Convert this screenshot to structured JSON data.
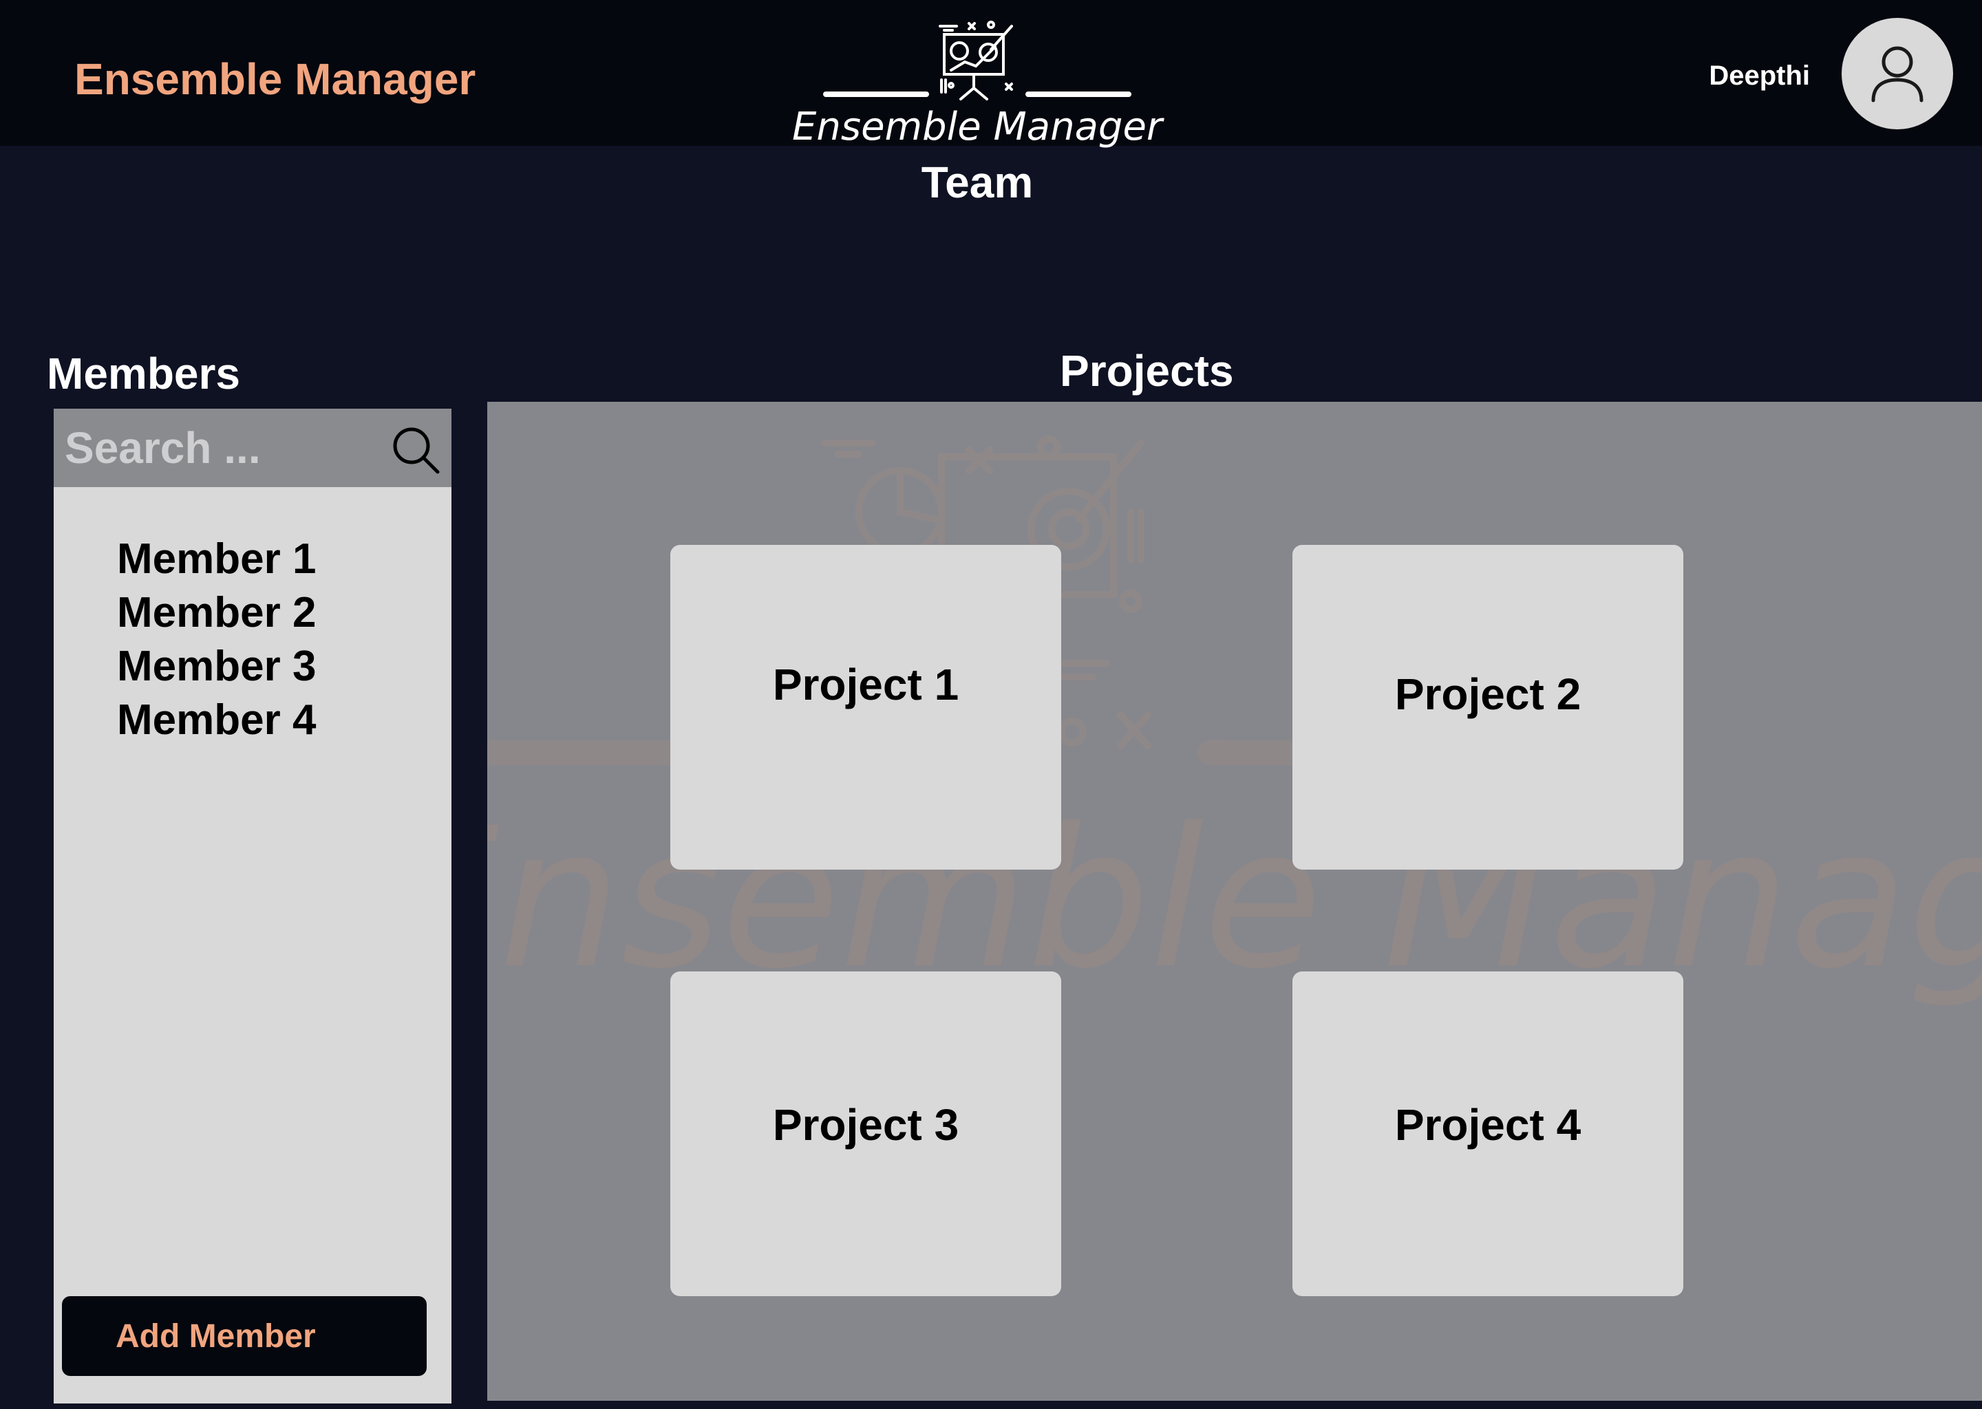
{
  "header": {
    "brand": "Ensemble Manager",
    "logo_text": "Ensemble Manager",
    "username": "Deepthi"
  },
  "page": {
    "title": "Team"
  },
  "members": {
    "heading": "Members",
    "search_placeholder": "Search ...",
    "items": [
      "Member 1",
      "Member 2",
      "Member 3",
      "Member 4"
    ],
    "add_button": "Add Member"
  },
  "projects": {
    "heading": "Projects",
    "items": [
      "Project 1",
      "Project 2",
      "Project 3",
      "Project 4"
    ],
    "watermark": "Ensemble Manager"
  },
  "colors": {
    "accent": "#f1a57f",
    "header_bg": "#05070e",
    "page_bg": "#0f1223",
    "panel_bg": "#d9d9d9",
    "projects_bg": "#86878c"
  }
}
